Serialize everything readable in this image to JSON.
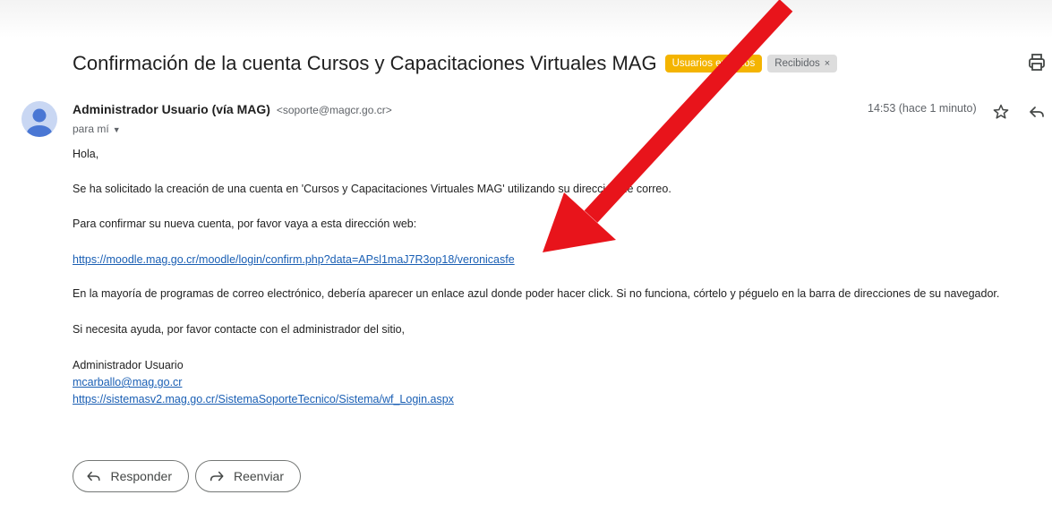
{
  "email": {
    "subject": "Confirmación de la cuenta Cursos y Capacitaciones Virtuales MAG",
    "labels": {
      "external": "Usuarios externos",
      "inbox": "Recibidos",
      "inbox_remove": "×"
    },
    "sender": {
      "name": "Administrador Usuario (vía MAG)",
      "email": "<soporte@magcr.go.cr>"
    },
    "to": "para mí",
    "time": "14:53 (hace 1 minuto)",
    "body": {
      "greeting": "Hola,",
      "p1": "Se ha solicitado la creación de una cuenta en 'Cursos y Capacitaciones Virtuales MAG' utilizando su dirección de correo.",
      "p2": "Para confirmar su nueva cuenta, por favor vaya a esta dirección web:",
      "confirm_link": "https://moodle.mag.go.cr/moodle/login/confirm.php?data=APsl1maJ7R3op18/veronicasfe",
      "p3": "En la mayoría de programas de correo electrónico, debería aparecer un enlace azul donde poder hacer click. Si no funciona, córtelo y péguelo en la barra de direcciones de su navegador.",
      "p4": "Si necesita ayuda, por favor contacte con el administrador del sitio,",
      "signature_name": "Administrador Usuario",
      "signature_email": "mcarballo@mag.go.cr",
      "signature_link": "https://sistemasv2.mag.go.cr/SistemaSoporteTecnico/Sistema/wf_Login.aspx"
    }
  },
  "actions": {
    "reply": "Responder",
    "forward": "Reenviar"
  },
  "colors": {
    "external_label": "#f4b400",
    "link": "#1a5fb4",
    "annotation_arrow": "#e8141b"
  },
  "icons": [
    "print-icon",
    "star-icon",
    "reply-icon",
    "forward-icon",
    "avatar-icon",
    "chevron-down-icon"
  ]
}
